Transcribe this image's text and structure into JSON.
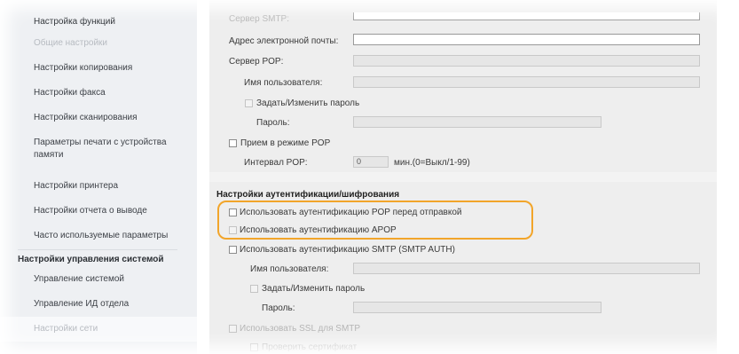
{
  "sidebar": {
    "header": "Настройка функций",
    "items": [
      "Общие настройки",
      "Настройки копирования",
      "Настройки факса",
      "Настройки сканирования",
      "Параметры печати с устройства памяти",
      "Настройки принтера",
      "Настройки отчета о выводе",
      "Часто используемые параметры"
    ],
    "section2": "Настройки управления системой",
    "items2": [
      "Управление системой",
      "Управление ИД отдела",
      "Настройки сети"
    ]
  },
  "form": {
    "smtp_server": "Сервер SMTP:",
    "email_address": "Адрес электронной почты:",
    "pop_server": "Сервер POP:",
    "pop_username": "Имя пользователя:",
    "set_change_password": "Задать/Изменить пароль",
    "password": "Пароль:",
    "pop_receive": "Прием в режиме POP",
    "pop_interval": "Интервал POP:",
    "pop_interval_value": "0",
    "pop_interval_unit": "мин.(0=Выкл/1-99)",
    "auth_heading": "Настройки аутентификации/шифрования",
    "pop_before_send": "Использовать аутентификацию POP перед отправкой",
    "apop": "Использовать аутентификацию APOP",
    "smtp_auth": "Использовать аутентификацию SMTP (SMTP AUTH)",
    "smtp_username": "Имя пользователя:",
    "smtp_set_change_password": "Задать/Изменить пароль",
    "smtp_password": "Пароль:",
    "ssl_smtp": "Использовать SSL для SMTP",
    "verify_cert": "Проверить сертификат"
  },
  "colors": {
    "highlight": "#f2a52a"
  }
}
